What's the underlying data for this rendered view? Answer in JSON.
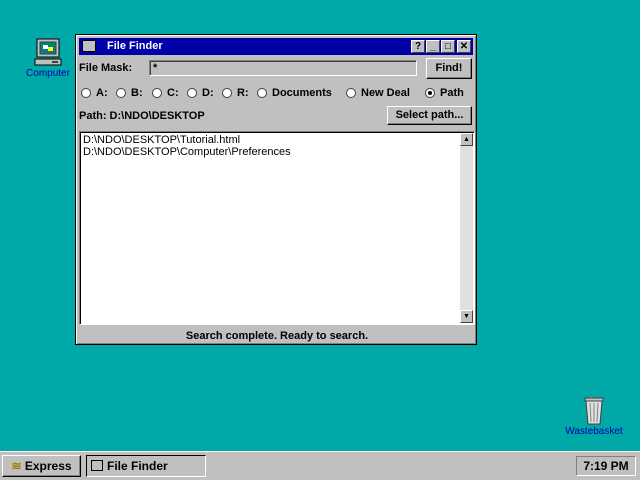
{
  "desktop": {
    "computer_label": "Computer",
    "wastebasket_label": "Wastebasket"
  },
  "window": {
    "title": "File Finder",
    "buttons": {
      "help": "?",
      "minimize": "_",
      "maximize": "□",
      "close": "✕"
    },
    "file_mask_label": "File Mask:",
    "file_mask_value": "*",
    "find_label": "Find!",
    "radios": [
      {
        "label": "A:",
        "selected": false
      },
      {
        "label": "B:",
        "selected": false
      },
      {
        "label": "C:",
        "selected": false
      },
      {
        "label": "D:",
        "selected": false
      },
      {
        "label": "R:",
        "selected": false
      },
      {
        "label": "Documents",
        "selected": false
      },
      {
        "label": "New Deal",
        "selected": false
      },
      {
        "label": "Path",
        "selected": true
      }
    ],
    "path_label": "Path: D:\\NDO\\DESKTOP",
    "select_path_label": "Select path...",
    "results": [
      "D:\\NDO\\DESKTOP\\Tutorial.html",
      "D:\\NDO\\DESKTOP\\Computer\\Preferences"
    ],
    "status": "Search complete.  Ready to search."
  },
  "taskbar": {
    "express_label": "Express",
    "task_label": "File Finder",
    "clock": "7:19 PM"
  },
  "colors": {
    "desktop": "#00a8a8",
    "titlebar": "#0000a8",
    "chrome": "#c0c0c0"
  }
}
